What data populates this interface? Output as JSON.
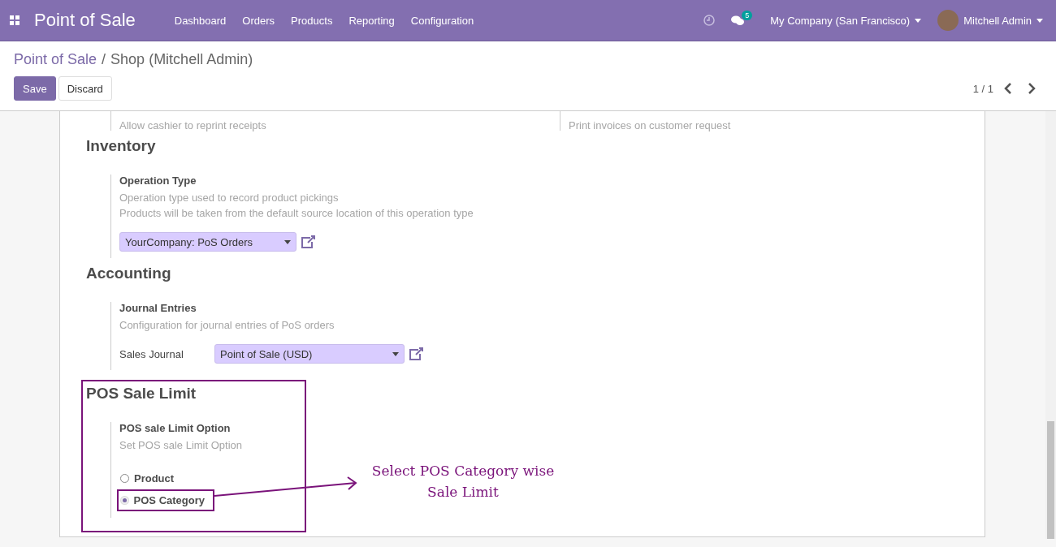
{
  "navbar": {
    "app_title": "Point of Sale",
    "menu": [
      "Dashboard",
      "Orders",
      "Products",
      "Reporting",
      "Configuration"
    ],
    "message_count": "5",
    "company": "My Company (San Francisco)",
    "user": "Mitchell Admin"
  },
  "breadcrumb": {
    "parent": "Point of Sale",
    "separator": "/",
    "current": "Shop (Mitchell Admin)"
  },
  "buttons": [
    {
      "label": "Save",
      "kind": "primary"
    },
    {
      "label": "Discard",
      "kind": "secondary"
    }
  ],
  "pager": "1 / 1",
  "top_settings": [
    {
      "description": "Allow cashier to reprint receipts"
    },
    {
      "description": "Print invoices on customer request"
    }
  ],
  "sections": [
    {
      "title": "Inventory",
      "highlighted": false,
      "setting": {
        "title": "Operation Type",
        "descriptions": [
          "Operation type used to record product pickings",
          "Products will be taken from the default source location of this operation type"
        ],
        "kind": "select",
        "value": "YourCompany: PoS Orders"
      }
    },
    {
      "title": "Accounting",
      "highlighted": false,
      "setting": {
        "title": "Journal Entries",
        "descriptions": [
          "Configuration for journal entries of PoS orders"
        ],
        "kind": "labeled_select",
        "field_label": "Sales Journal",
        "value": "Point of Sale (USD)"
      }
    },
    {
      "title": "POS Sale Limit",
      "highlighted": true,
      "setting": {
        "title": "POS sale Limit Option",
        "descriptions": [
          "Set POS sale Limit Option"
        ],
        "kind": "radio",
        "options": [
          {
            "label": "Product",
            "selected": false
          },
          {
            "label": "POS Category",
            "selected": true
          }
        ]
      }
    }
  ],
  "annotation": {
    "lines": [
      "Select POS Category wise",
      "Sale Limit"
    ]
  }
}
